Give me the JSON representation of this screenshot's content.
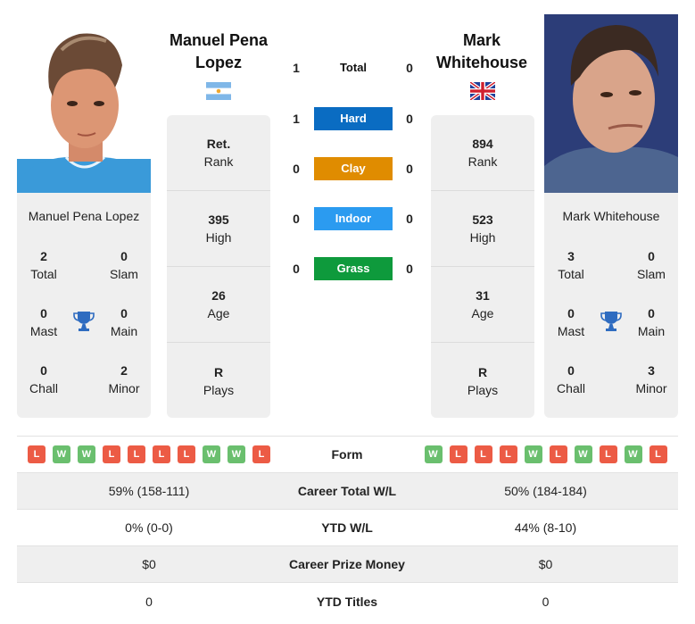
{
  "colors": {
    "hard": "#0a6cc2",
    "clay": "#e08c00",
    "indoor": "#2b9bf0",
    "grass": "#0e9a3c",
    "win": "#6abf6e",
    "loss": "#ec5b45",
    "trophy": "#2f6cc0"
  },
  "player1": {
    "header_name_line1": "Manuel Pena",
    "header_name_line2": "Lopez",
    "country_flag": "argentina-flag",
    "card_name": "Manuel Pena Lopez",
    "titles": {
      "total": "2",
      "total_label": "Total",
      "slam": "0",
      "slam_label": "Slam",
      "mast": "0",
      "mast_label": "Mast",
      "main": "0",
      "main_label": "Main",
      "chall": "0",
      "chall_label": "Chall",
      "minor": "2",
      "minor_label": "Minor"
    },
    "rank": "Ret.",
    "rank_label": "Rank",
    "high": "395",
    "high_label": "High",
    "age": "26",
    "age_label": "Age",
    "plays": "R",
    "plays_label": "Plays",
    "form": [
      "L",
      "W",
      "W",
      "L",
      "L",
      "L",
      "L",
      "W",
      "W",
      "L"
    ],
    "career_wl": "59% (158-111)",
    "ytd_wl": "0% (0-0)",
    "prize_money": "$0",
    "ytd_titles": "0"
  },
  "player2": {
    "header_name_line1": "Mark",
    "header_name_line2": "Whitehouse",
    "country_flag": "united-kingdom-flag",
    "card_name": "Mark Whitehouse",
    "titles": {
      "total": "3",
      "total_label": "Total",
      "slam": "0",
      "slam_label": "Slam",
      "mast": "0",
      "mast_label": "Mast",
      "main": "0",
      "main_label": "Main",
      "chall": "0",
      "chall_label": "Chall",
      "minor": "3",
      "minor_label": "Minor"
    },
    "rank": "894",
    "rank_label": "Rank",
    "high": "523",
    "high_label": "High",
    "age": "31",
    "age_label": "Age",
    "plays": "R",
    "plays_label": "Plays",
    "form": [
      "W",
      "L",
      "L",
      "L",
      "W",
      "L",
      "W",
      "L",
      "W",
      "L"
    ],
    "career_wl": "50% (184-184)",
    "ytd_wl": "44% (8-10)",
    "prize_money": "$0",
    "ytd_titles": "0"
  },
  "h2h": [
    {
      "label": "Total",
      "p1": "1",
      "p2": "0"
    },
    {
      "label": "Hard",
      "p1": "1",
      "p2": "0"
    },
    {
      "label": "Clay",
      "p1": "0",
      "p2": "0"
    },
    {
      "label": "Indoor",
      "p1": "0",
      "p2": "0"
    },
    {
      "label": "Grass",
      "p1": "0",
      "p2": "0"
    }
  ],
  "table": {
    "form_label": "Form",
    "career_wl_label": "Career Total W/L",
    "ytd_wl_label": "YTD W/L",
    "prize_label": "Career Prize Money",
    "ytd_titles_label": "YTD Titles"
  }
}
